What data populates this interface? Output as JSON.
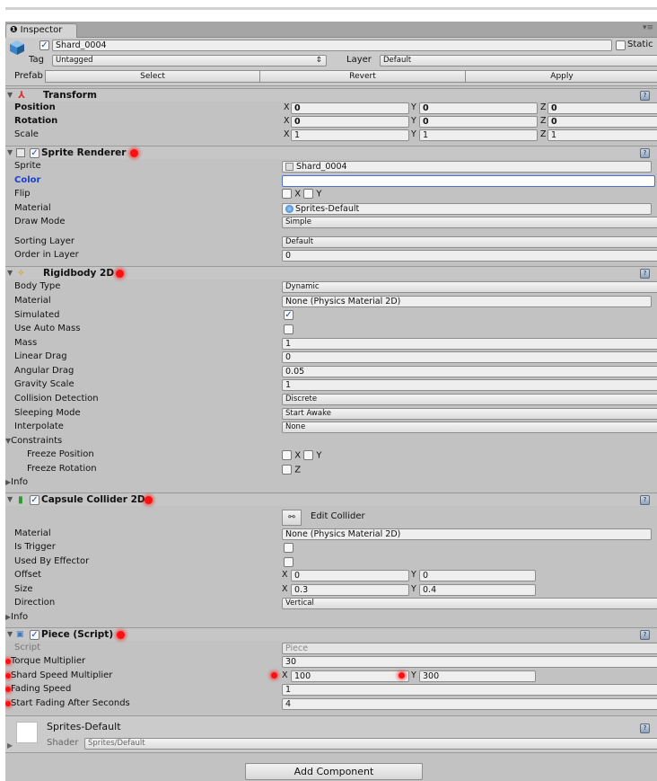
{
  "tab": {
    "label": "Inspector"
  },
  "header": {
    "name": "Shard_0004",
    "static_label": "Static",
    "tag_label": "Tag",
    "tag_value": "Untagged",
    "layer_label": "Layer",
    "layer_value": "Default",
    "prefab_label": "Prefab",
    "select_label": "Select",
    "revert_label": "Revert",
    "apply_label": "Apply"
  },
  "transform": {
    "title": "Transform",
    "rows": [
      {
        "label": "Position",
        "x": "0",
        "y": "0",
        "z": "0"
      },
      {
        "label": "Rotation",
        "x": "0",
        "y": "0",
        "z": "0"
      },
      {
        "label": "Scale",
        "x": "1",
        "y": "1",
        "z": "1"
      }
    ]
  },
  "axes": {
    "x": "X",
    "y": "Y",
    "z": "Z"
  },
  "sprite_renderer": {
    "title": "Sprite Renderer",
    "sprite_label": "Sprite",
    "sprite_value": "Shard_0004",
    "color_label": "Color",
    "color_value": "#ffffff",
    "flip_label": "Flip",
    "material_label": "Material",
    "material_value": "Sprites-Default",
    "draw_mode_label": "Draw Mode",
    "draw_mode_value": "Simple",
    "sorting_layer_label": "Sorting Layer",
    "sorting_layer_value": "Default",
    "order_label": "Order in Layer",
    "order_value": "0"
  },
  "rigidbody": {
    "title": "Rigidbody 2D",
    "body_type_label": "Body Type",
    "body_type_value": "Dynamic",
    "material_label": "Material",
    "material_value": "None (Physics Material 2D)",
    "simulated_label": "Simulated",
    "simulated": true,
    "auto_mass_label": "Use Auto Mass",
    "auto_mass": false,
    "mass_label": "Mass",
    "mass_value": "1",
    "linear_drag_label": "Linear Drag",
    "linear_drag_value": "0",
    "angular_drag_label": "Angular Drag",
    "angular_drag_value": "0.05",
    "gravity_label": "Gravity Scale",
    "gravity_value": "1",
    "collision_label": "Collision Detection",
    "collision_value": "Discrete",
    "sleeping_label": "Sleeping Mode",
    "sleeping_value": "Start Awake",
    "interpolate_label": "Interpolate",
    "interpolate_value": "None",
    "constraints_label": "Constraints",
    "freeze_pos_label": "Freeze Position",
    "freeze_rot_label": "Freeze Rotation",
    "info_label": "Info"
  },
  "capsule": {
    "title": "Capsule Collider 2D",
    "edit_label": "Edit Collider",
    "material_label": "Material",
    "material_value": "None (Physics Material 2D)",
    "trigger_label": "Is Trigger",
    "effector_label": "Used By Effector",
    "offset_label": "Offset",
    "offset_x": "0",
    "offset_y": "0",
    "size_label": "Size",
    "size_x": "0.3",
    "size_y": "0.4",
    "direction_label": "Direction",
    "direction_value": "Vertical",
    "info_label": "Info"
  },
  "piece": {
    "title": "Piece (Script)",
    "script_label": "Script",
    "script_value": "Piece",
    "torque_label": "Torque Multiplier",
    "torque_value": "30",
    "shard_label": "Shard Speed Multiplier",
    "shard_x": "100",
    "shard_y": "300",
    "fading_label": "Fading Speed",
    "fading_value": "1",
    "start_label": "Start Fading After Seconds",
    "start_value": "4"
  },
  "material_asset": {
    "name": "Sprites-Default",
    "shader_label": "Shader",
    "shader_value": "Sprites/Default"
  },
  "add_component": {
    "label": "Add Component"
  }
}
